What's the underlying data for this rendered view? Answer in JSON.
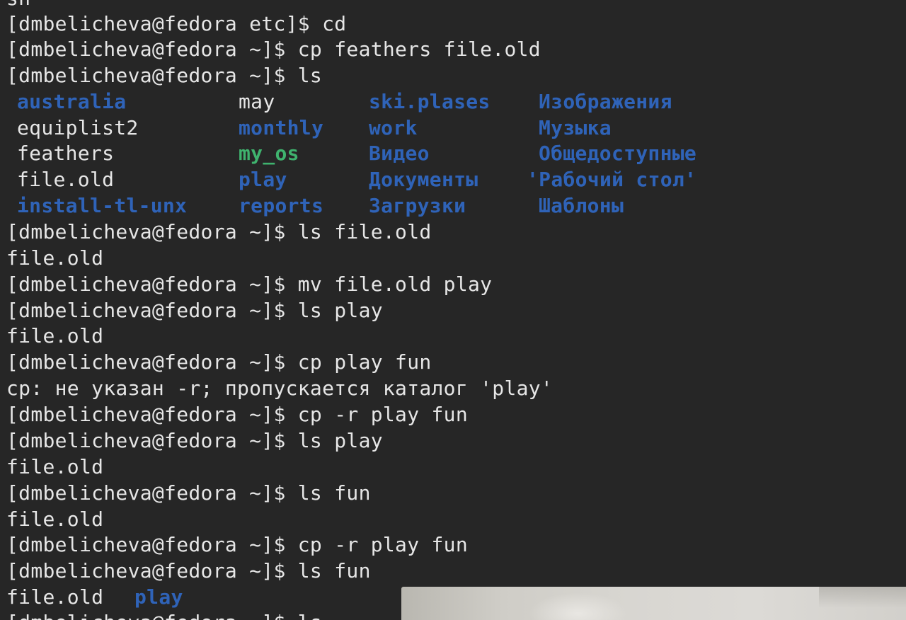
{
  "terminal": {
    "prompt": "[dmbelicheva@fedora ~]$",
    "lines": [
      "sh",
      "[dmbelicheva@fedora etc]$ cd",
      "[dmbelicheva@fedora ~]$ cp feathers file.old",
      "[dmbelicheva@fedora ~]$ ls",
      "",
      "",
      "",
      "",
      "",
      "[dmbelicheva@fedora ~]$ ls file.old",
      "file.old",
      "[dmbelicheva@fedora ~]$ mv file.old play",
      "[dmbelicheva@fedora ~]$ ls play",
      "file.old",
      "[dmbelicheva@fedora ~]$ cp play fun",
      "cp: не указан -r; пропускается каталог 'play'",
      "[dmbelicheva@fedora ~]$ cp -r play fun",
      "[dmbelicheva@fedora ~]$ ls play",
      "file.old",
      "[dmbelicheva@fedora ~]$ ls fun",
      "file.old",
      "[dmbelicheva@fedora ~]$ cp -r play fun",
      "[dmbelicheva@fedora ~]$ ls fun",
      "",
      "[dmbelicheva@fedora ~]$ ls"
    ],
    "ls_listing": {
      "col1": [
        {
          "name": "australia",
          "kind": "dir"
        },
        {
          "name": "equiplist2",
          "kind": "file"
        },
        {
          "name": "feathers",
          "kind": "file"
        },
        {
          "name": "file.old",
          "kind": "file"
        },
        {
          "name": "install-tl-unx",
          "kind": "dir"
        }
      ],
      "col2": [
        {
          "name": "may",
          "kind": "file"
        },
        {
          "name": "monthly",
          "kind": "dir"
        },
        {
          "name": "my_os",
          "kind": "exec"
        },
        {
          "name": "play",
          "kind": "dir"
        },
        {
          "name": "reports",
          "kind": "dir"
        }
      ],
      "col3": [
        {
          "name": "ski.plases",
          "kind": "dir"
        },
        {
          "name": "work",
          "kind": "dir"
        },
        {
          "name": "Видео",
          "kind": "dir"
        },
        {
          "name": "Документы",
          "kind": "dir"
        },
        {
          "name": "Загрузки",
          "kind": "dir"
        }
      ],
      "col4": [
        {
          "name": "Изображения",
          "kind": "dir"
        },
        {
          "name": "Музыка",
          "kind": "dir"
        },
        {
          "name": "Общедоступные",
          "kind": "dir"
        },
        {
          "name": "'Рабочий стол'",
          "kind": "dir"
        },
        {
          "name": "Шаблоны",
          "kind": "dir"
        }
      ]
    },
    "ls_fun_output": [
      {
        "name": "file.old",
        "kind": "file"
      },
      {
        "name": "play",
        "kind": "dir"
      }
    ],
    "colors": {
      "background": "#262626",
      "text": "#e6e6e6",
      "directory": "#2f63b8",
      "executable": "#3fb36e"
    }
  }
}
